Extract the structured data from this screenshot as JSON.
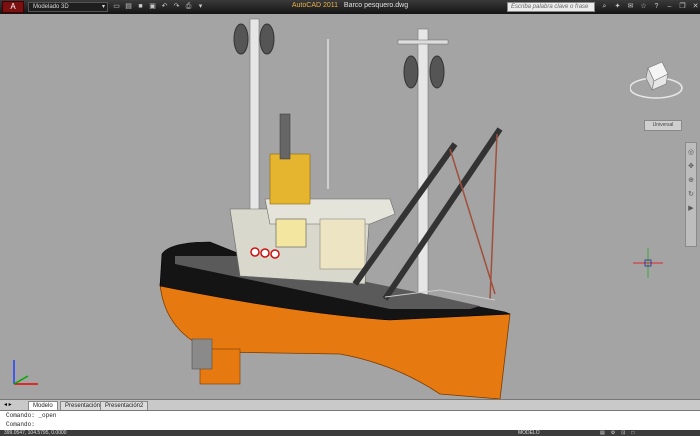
{
  "titlebar": {
    "app_button": "A",
    "workspace": "Modelado 3D",
    "app_name": "AutoCAD 2011",
    "file_name": "Barco pesquero.dwg",
    "search_placeholder": "Escriba palabra clave o frase"
  },
  "viewport": {
    "world_label": "Universal"
  },
  "tabs": [
    {
      "label": "Modelo"
    },
    {
      "label": "Presentación1"
    },
    {
      "label": "Presentación2"
    }
  ],
  "command": {
    "line1": "Comando: _open",
    "line2": "Comando:"
  },
  "status": {
    "coords": "399.0547, 104.5795, 0.0000",
    "model": "MODELO"
  },
  "colors": {
    "hull_orange": "#e67a10",
    "hull_black": "#141414",
    "cabin": "#d8d8cc",
    "viewport_bg": "#a4a4a4"
  }
}
